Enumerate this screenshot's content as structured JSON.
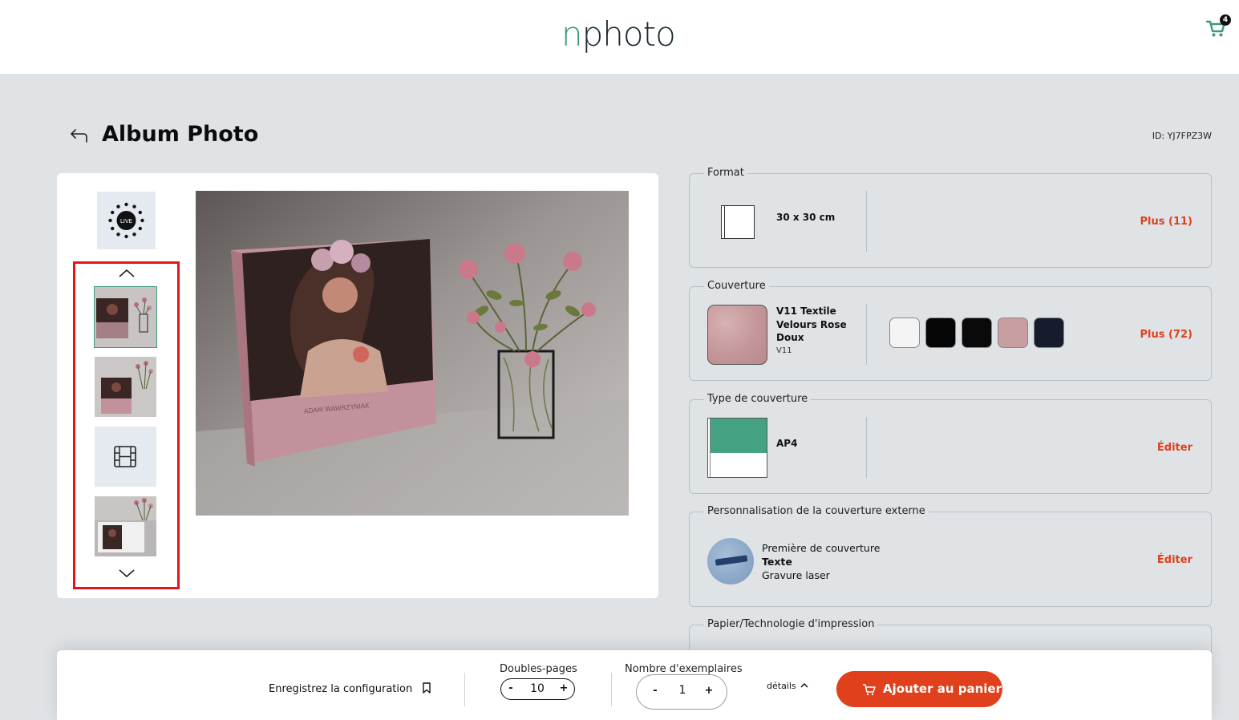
{
  "header": {
    "logo_n": "n",
    "logo_rest": "photo",
    "cart_count": "4"
  },
  "page": {
    "title": "Album Photo",
    "id_label": "ID: YJ7FPZ3W"
  },
  "preview": {
    "live_label": "LIVE",
    "book_spine_text": "ADAM WAWRZYNIAK",
    "thumbnails": [
      {
        "kind": "photo",
        "selected": true
      },
      {
        "kind": "photo",
        "selected": false
      },
      {
        "kind": "video",
        "selected": false
      },
      {
        "kind": "photo",
        "selected": false
      }
    ]
  },
  "options": {
    "format": {
      "legend": "Format",
      "value": "30 x 30 cm",
      "action": "Plus (11)"
    },
    "cover": {
      "legend": "Couverture",
      "name_line1": "V11 Textile",
      "name_line2": "Velours Rose",
      "name_line3": "Doux",
      "code": "V11",
      "action": "Plus (72)",
      "swatches": [
        {
          "color": "#f4f4f4",
          "name": "white-textile-swatch"
        },
        {
          "color": "#050505",
          "name": "black-textile-swatch"
        },
        {
          "color": "#0a0a0a",
          "name": "black-velvet-swatch"
        },
        {
          "color": "#c99ea0",
          "name": "pink-velvet-swatch"
        },
        {
          "color": "#161c2c",
          "name": "navy-textile-swatch"
        }
      ]
    },
    "cover_type": {
      "legend": "Type de couverture",
      "value": "AP4",
      "action": "Éditer"
    },
    "personalization": {
      "legend": "Personnalisation de la couverture externe",
      "line1": "Première de couverture",
      "line2": "Texte",
      "line3": "Gravure laser",
      "action": "Éditer"
    },
    "paper": {
      "legend": "Papier/Technologie d'impression"
    }
  },
  "bottom_bar": {
    "save_label": "Enregistrez la configuration",
    "pages_label": "Doubles-pages",
    "pages_value": "10",
    "copies_label": "Nombre d'exemplaires",
    "copies_value": "1",
    "minus": "-",
    "plus": "+",
    "details_label": "détails",
    "add_to_cart_label": "Ajouter au panier"
  },
  "colors": {
    "accent": "#e0401c",
    "brand_green": "#3a9a7a",
    "page_bg": "#dfe3e6",
    "highlight_border": "#e4141b"
  }
}
